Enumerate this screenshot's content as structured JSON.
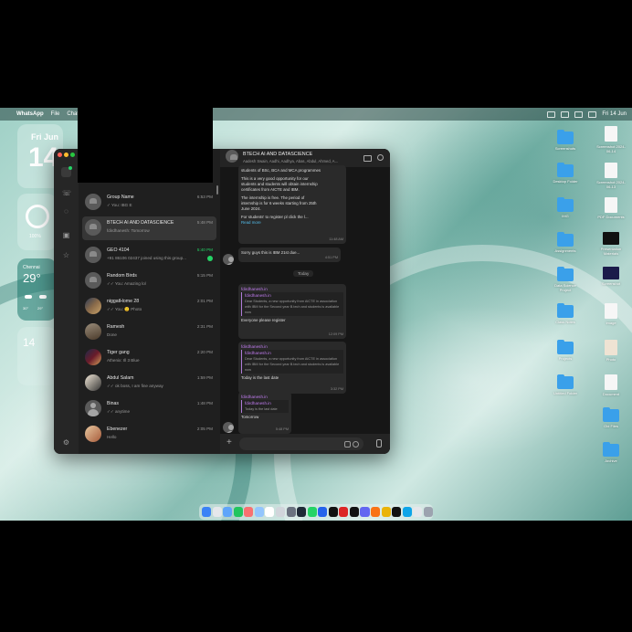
{
  "menubar": {
    "app": "WhatsApp",
    "menu1": "File",
    "menu2": "Chat",
    "datetime": "Fri 14 Jun"
  },
  "widgets": {
    "calendar_day": "Fri Jun",
    "calendar_date": "14",
    "battery_percent": "100%",
    "weather_city": "Chennai",
    "weather_temp": "29°",
    "temps": [
      "30°",
      "29°",
      "29°",
      "28°"
    ],
    "reminder_date": "14"
  },
  "whatsapp": {
    "chat_title": "BTECH AI AND DATASCIENCE",
    "chat_members": "Aadesh Swain, Aadhi, Aadhya, Abas, Abdul, Ahmed, A...",
    "chats": [
      {
        "name": "Group Name",
        "preview": "✓ You: IBG E",
        "time": "6:53 PM",
        "avatar": "group",
        "time_green": false
      },
      {
        "name": "BTECH AI AND DATASCIENCE",
        "preview": "fdirdhanesh: Tomorrow",
        "time": "5:48 PM",
        "avatar": "group",
        "time_green": false,
        "selected": true
      },
      {
        "name": "GEO 4104",
        "preview": "+91 86106 02437 joined using this group...",
        "time": "5:40 PM",
        "avatar": "group",
        "time_green": true,
        "badge": true
      },
      {
        "name": "Random Birds",
        "preview": "✓✓ You: Amazing lol",
        "time": "5:15 PM",
        "avatar": "group",
        "time_green": false
      },
      {
        "name": "niggatHome 28",
        "preview": "✓✓ You: 🙂 Photo",
        "time": "2:01 PM",
        "avatar": "photo1",
        "time_green": false
      },
      {
        "name": "Ramesh",
        "preview": "Done",
        "time": "2:31 PM",
        "avatar": "photo2",
        "time_green": false
      },
      {
        "name": "Tiger gang",
        "preview": "Athenix: Ill 3 Blue",
        "time": "2:20 PM",
        "avatar": "photo3",
        "time_green": false
      },
      {
        "name": "Abdul Salam",
        "preview": "✓✓ ok boss, I am fine anyway",
        "time": "1:59 PM",
        "avatar": "photo4",
        "time_green": false
      },
      {
        "name": "Binas",
        "preview": "✓✓ anytime",
        "time": "1:48 PM",
        "avatar": "person",
        "time_green": false
      },
      {
        "name": "Ebenezer",
        "preview": "Hello",
        "time": "2:05 PM",
        "avatar": "photo5",
        "time_green": false
      }
    ],
    "messages": {
      "m1_line1": "students of BSc, BCA and MCA programmes",
      "m1_line2": "This is a very good opportunity for our",
      "m1_line3": "students and students will obtain internship",
      "m1_line4": "certificates from AICTE and IBM.",
      "m1_line5": "The internship is free. The period of",
      "m1_line6": "internship is for 6 weeks starting from 25th",
      "m1_line7": "June 2024.",
      "m1_line8": "For students' to register pl click the l...",
      "m1_readmore": "Read more",
      "m1_time": "11:48 AM",
      "m2_text": "Sorry guys this is IBM 21st due...",
      "m2_time": "4:51 PM",
      "date_divider": "Today",
      "m3_sender": "fdirdhanesh.in",
      "m3_quote_name": "fdirdhanesh.in",
      "m3_quote": "Dear Students, a new opportunity from AICTE in association with IBM for the Second year B.tech and students is available now",
      "m3_text": "Everyone please register",
      "m3_time": "12:09 PM",
      "m4_sender": "fdirdhanesh.in",
      "m4_quote_name": "fdirdhanesh.in",
      "m4_quote": "Dear Students, a new opportunity from AICTE in association with IBM for the Second year B.tech and students is available now",
      "m4_text": "Today is the last date",
      "m4_time": "3:32 PM",
      "m5_sender": "fdirdhanesh.in",
      "m5_quote_name": "fdirdhanesh.in",
      "m5_quote": "Today is the last date",
      "m5_text": "Tomorrow",
      "m5_time": "5:48 PM"
    },
    "composer_placeholder": ""
  },
  "desktop_icons": [
    {
      "label": "Screenshots"
    },
    {
      "label": "Screenshot 2024-06-14"
    },
    {
      "label": "Desktop Folder"
    },
    {
      "label": "Screenshot 2024-06-13"
    },
    {
      "label": "IMG"
    },
    {
      "label": "PDF Documents"
    },
    {
      "label": "Assignments"
    },
    {
      "label": "Presentation Materials"
    },
    {
      "label": "Data Science Project"
    },
    {
      "label": "Screenshot"
    },
    {
      "label": "Class Notes"
    },
    {
      "label": "Image"
    },
    {
      "label": "Projects"
    },
    {
      "label": "Photo"
    },
    {
      "label": "Untitled Folder"
    },
    {
      "label": "Document"
    },
    {
      "label": "Old Files"
    },
    {
      "label": "Archive"
    }
  ],
  "colors": {
    "accent": "#25d366",
    "quote_accent": "#b07cd8",
    "folder": "#3aa0ea"
  }
}
